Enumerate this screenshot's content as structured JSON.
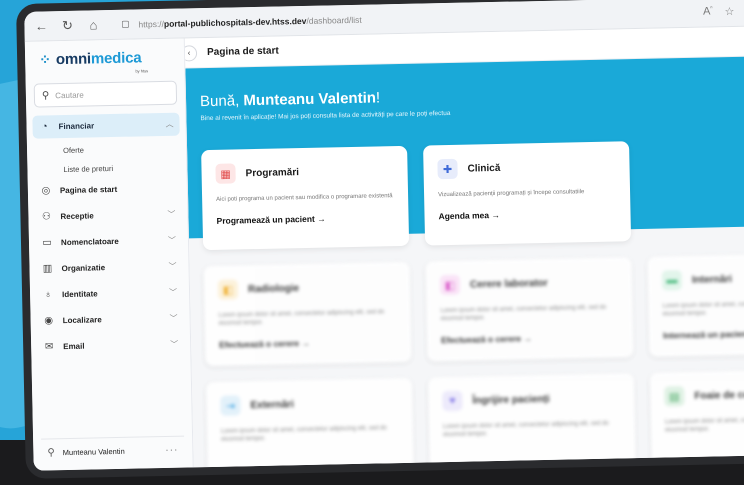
{
  "browser": {
    "url_scheme": "https://",
    "url_host": "portal-publichospitals-dev.htss.dev",
    "url_path": "/dashboard/list",
    "icons": [
      "back-icon",
      "refresh-icon",
      "home-icon",
      "tab-icon",
      "read-aloud-icon",
      "favorite-icon"
    ]
  },
  "brand": {
    "name_prefix": "omni",
    "name_suffix": "medica",
    "byline": "by htss",
    "primary_color": "#1e9ad6",
    "dark_color": "#173b63"
  },
  "search": {
    "placeholder": "Cautare"
  },
  "sidebar": {
    "items": [
      {
        "label": "Financiar",
        "icon": "finance-icon",
        "expanded": true,
        "children": [
          "Oferte",
          "Liste de preturi"
        ]
      },
      {
        "label": "Pagina de start",
        "icon": "home-icon"
      },
      {
        "label": "Receptie",
        "icon": "reception-icon"
      },
      {
        "label": "Nomenclatoare",
        "icon": "book-icon"
      },
      {
        "label": "Organizatie",
        "icon": "building-icon"
      },
      {
        "label": "Identitate",
        "icon": "users-icon"
      },
      {
        "label": "Localizare",
        "icon": "location-icon"
      },
      {
        "label": "Email",
        "icon": "mail-icon"
      }
    ],
    "user": "Munteanu Valentin"
  },
  "header": {
    "title": "Pagina de start"
  },
  "hero": {
    "greeting_prefix": "Bună, ",
    "greeting_name": "Munteanu Valentin",
    "greeting_suffix": "!",
    "subtitle": "Bine ai revenit în aplicație! Mai jos poți consulta lista de activități pe care le poți efectua",
    "color": "#1aa9d8"
  },
  "cards": [
    {
      "title": "Programări",
      "icon": "calendar-icon",
      "description": "Aici poti programa un pacient sau modifica o programare existentă",
      "action": "Programează un pacient →"
    },
    {
      "title": "Clinică",
      "icon": "medical-cross-icon",
      "description": "Vizualizează pacienții programați și începe consultatiile",
      "action": "Agenda mea →"
    }
  ],
  "blurred_cards": [
    {
      "title": "Radiologie",
      "icon": "radiology-icon",
      "color": "#f7b733",
      "description": "Lorem ipsum dolor sit amet, consectetur adipiscing elit, sed do eiusmod tempor.",
      "action": "Efectuează o cerere →"
    },
    {
      "title": "Cerere laborator",
      "icon": "lab-icon",
      "color": "#e45bd3",
      "description": "Lorem ipsum dolor sit amet, consectetur adipiscing elit, sed do eiusmod tempor.",
      "action": "Efectuează o cerere →"
    },
    {
      "title": "Internări",
      "icon": "bed-icon",
      "color": "#3bbf7a",
      "description": "Lorem ipsum dolor sit amet, consectetur adipiscing elit, sed do eiusmod tempor.",
      "action": "Internează un pacient →"
    },
    {
      "title": "Externări",
      "icon": "exit-icon",
      "color": "#2b9be0",
      "description": "Lorem ipsum dolor sit amet, consectetur adipiscing elit, sed do eiusmod tempor.",
      "action": ""
    },
    {
      "title": "Îngrijire pacienți",
      "icon": "care-icon",
      "color": "#7b6ee6",
      "description": "Lorem ipsum dolor sit amet, consectetur adipiscing elit, sed do eiusmod tempor.",
      "action": ""
    },
    {
      "title": "Foaie de co",
      "icon": "sheet-icon",
      "color": "#2e9d4f",
      "description": "Lorem ipsum dolor sit amet, consectetur adipiscing elit, sed do eiusmod tempor.",
      "action": ""
    }
  ]
}
